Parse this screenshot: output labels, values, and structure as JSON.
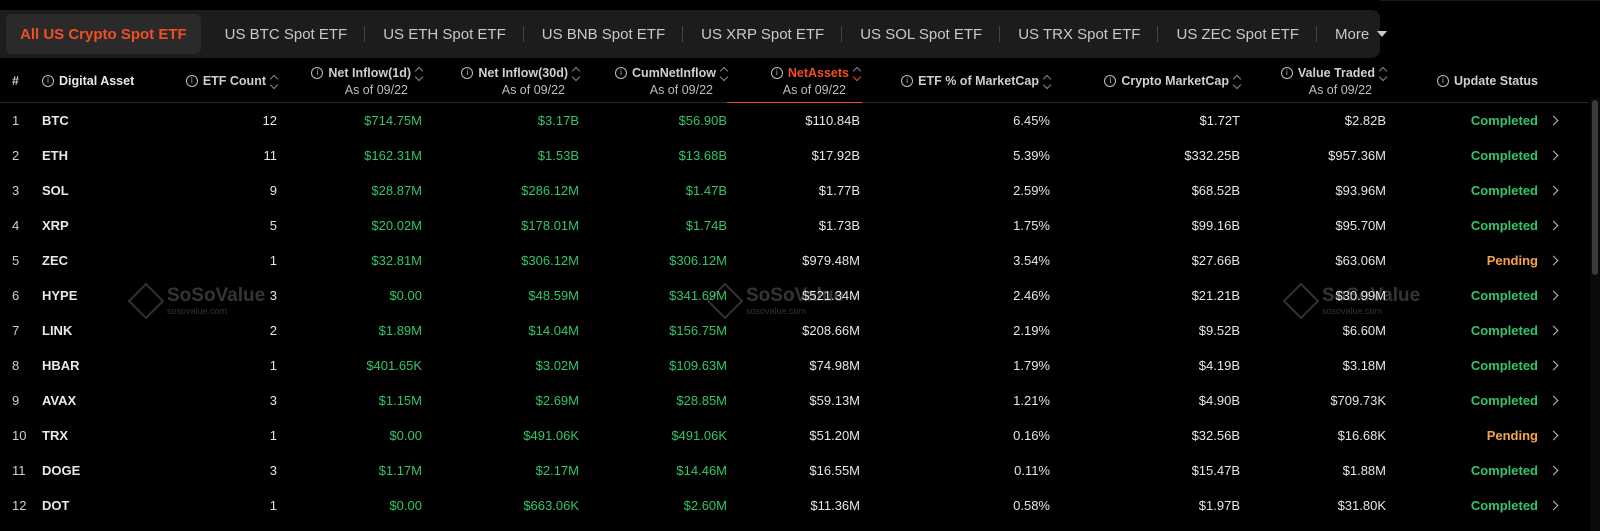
{
  "tabs": [
    {
      "label": "All US Crypto Spot ETF",
      "active": true
    },
    {
      "label": "US BTC Spot ETF"
    },
    {
      "label": "US ETH Spot ETF"
    },
    {
      "label": "US BNB Spot ETF"
    },
    {
      "label": "US XRP Spot ETF"
    },
    {
      "label": "US SOL Spot ETF"
    },
    {
      "label": "US TRX Spot ETF"
    },
    {
      "label": "US ZEC Spot ETF"
    },
    {
      "label": "More"
    }
  ],
  "headers": {
    "idx": "#",
    "asset": "Digital Asset",
    "count": "ETF Count",
    "inflow1d": "Net Inflow(1d)",
    "inflow1d_sub": "As of 09/22",
    "inflow30d": "Net Inflow(30d)",
    "inflow30d_sub": "As of 09/22",
    "cum": "CumNetInflow",
    "cum_sub": "As of 09/22",
    "net": "NetAssets",
    "net_sub": "As of 09/22",
    "pct": "ETF % of MarketCap",
    "mcap": "Crypto MarketCap",
    "vt": "Value Traded",
    "vt_sub": "As of 09/22",
    "status": "Update Status"
  },
  "rows": [
    {
      "idx": "1",
      "asset": "BTC",
      "count": "12",
      "in1d": "$714.75M",
      "in30d": "$3.17B",
      "cum": "$56.90B",
      "net": "$110.84B",
      "pct": "6.45%",
      "mcap": "$1.72T",
      "vt": "$2.82B",
      "status": "Completed"
    },
    {
      "idx": "2",
      "asset": "ETH",
      "count": "11",
      "in1d": "$162.31M",
      "in30d": "$1.53B",
      "cum": "$13.68B",
      "net": "$17.92B",
      "pct": "5.39%",
      "mcap": "$332.25B",
      "vt": "$957.36M",
      "status": "Completed"
    },
    {
      "idx": "3",
      "asset": "SOL",
      "count": "9",
      "in1d": "$28.87M",
      "in30d": "$286.12M",
      "cum": "$1.47B",
      "net": "$1.77B",
      "pct": "2.59%",
      "mcap": "$68.52B",
      "vt": "$93.96M",
      "status": "Completed"
    },
    {
      "idx": "4",
      "asset": "XRP",
      "count": "5",
      "in1d": "$20.02M",
      "in30d": "$178.01M",
      "cum": "$1.74B",
      "net": "$1.73B",
      "pct": "1.75%",
      "mcap": "$99.16B",
      "vt": "$95.70M",
      "status": "Completed"
    },
    {
      "idx": "5",
      "asset": "ZEC",
      "count": "1",
      "in1d": "$32.81M",
      "in30d": "$306.12M",
      "cum": "$306.12M",
      "net": "$979.48M",
      "pct": "3.54%",
      "mcap": "$27.66B",
      "vt": "$63.06M",
      "status": "Pending"
    },
    {
      "idx": "6",
      "asset": "HYPE",
      "count": "3",
      "in1d": "$0.00",
      "in30d": "$48.59M",
      "cum": "$341.69M",
      "net": "$521.34M",
      "pct": "2.46%",
      "mcap": "$21.21B",
      "vt": "$30.99M",
      "status": "Completed"
    },
    {
      "idx": "7",
      "asset": "LINK",
      "count": "2",
      "in1d": "$1.89M",
      "in30d": "$14.04M",
      "cum": "$156.75M",
      "net": "$208.66M",
      "pct": "2.19%",
      "mcap": "$9.52B",
      "vt": "$6.60M",
      "status": "Completed"
    },
    {
      "idx": "8",
      "asset": "HBAR",
      "count": "1",
      "in1d": "$401.65K",
      "in30d": "$3.02M",
      "cum": "$109.63M",
      "net": "$74.98M",
      "pct": "1.79%",
      "mcap": "$4.19B",
      "vt": "$3.18M",
      "status": "Completed"
    },
    {
      "idx": "9",
      "asset": "AVAX",
      "count": "3",
      "in1d": "$1.15M",
      "in30d": "$2.69M",
      "cum": "$28.85M",
      "net": "$59.13M",
      "pct": "1.21%",
      "mcap": "$4.90B",
      "vt": "$709.73K",
      "status": "Completed"
    },
    {
      "idx": "10",
      "asset": "TRX",
      "count": "1",
      "in1d": "$0.00",
      "in30d": "$491.06K",
      "cum": "$491.06K",
      "net": "$51.20M",
      "pct": "0.16%",
      "mcap": "$32.56B",
      "vt": "$16.68K",
      "status": "Pending"
    },
    {
      "idx": "11",
      "asset": "DOGE",
      "count": "3",
      "in1d": "$1.17M",
      "in30d": "$2.17M",
      "cum": "$14.46M",
      "net": "$16.55M",
      "pct": "0.11%",
      "mcap": "$15.47B",
      "vt": "$1.88M",
      "status": "Completed"
    },
    {
      "idx": "12",
      "asset": "DOT",
      "count": "1",
      "in1d": "$0.00",
      "in30d": "$663.06K",
      "cum": "$2.60M",
      "net": "$11.36M",
      "pct": "0.58%",
      "mcap": "$1.97B",
      "vt": "$31.80K",
      "status": "Completed"
    }
  ],
  "watermark": {
    "brand": "SoSoValue",
    "url": "sosovalue.com"
  },
  "colors": {
    "accent": "#f04e23",
    "positive": "#33c46a",
    "pending": "#f5a44a"
  }
}
